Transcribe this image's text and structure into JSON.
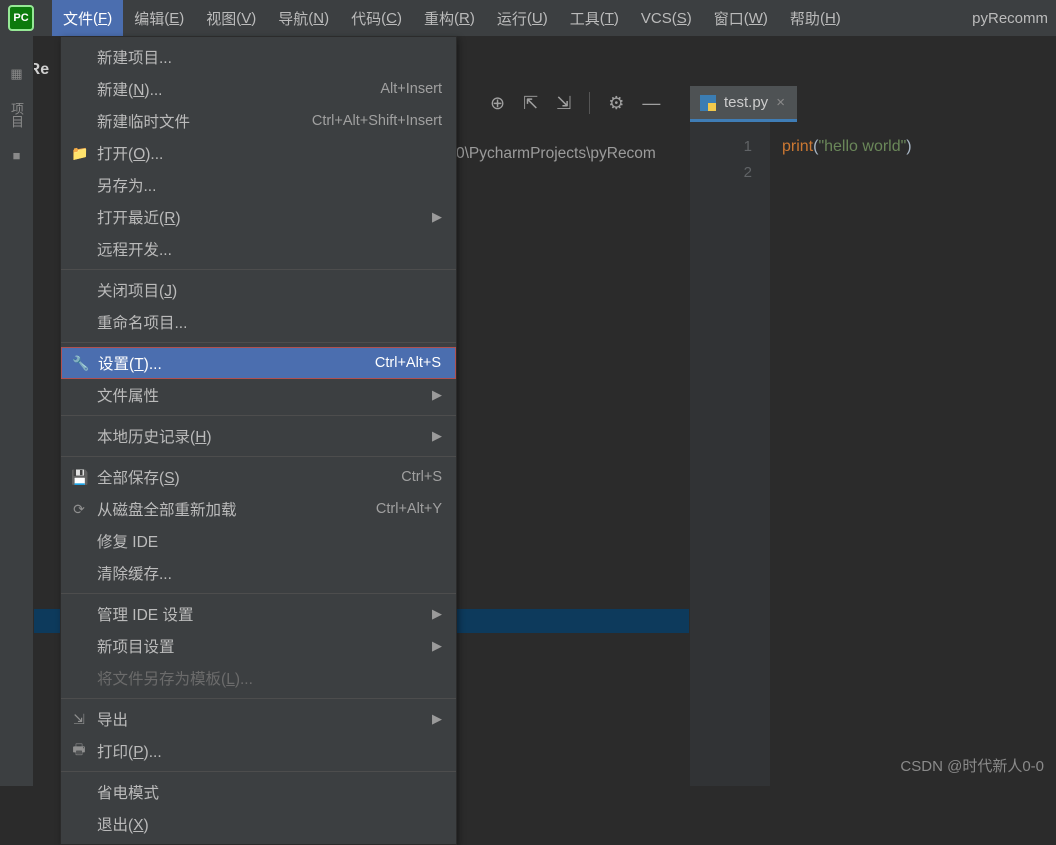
{
  "app": {
    "icon_text": "PC",
    "project_title": "pyRecomm"
  },
  "menus": {
    "file": {
      "label": "文件",
      "mn": "F"
    },
    "edit": {
      "label": "编辑",
      "mn": "E"
    },
    "view": {
      "label": "视图",
      "mn": "V"
    },
    "navigate": {
      "label": "导航",
      "mn": "N"
    },
    "code": {
      "label": "代码",
      "mn": "C"
    },
    "refactor": {
      "label": "重构",
      "mn": "R"
    },
    "run": {
      "label": "运行",
      "mn": "U"
    },
    "tools": {
      "label": "工具",
      "mn": "T"
    },
    "vcs": {
      "label": "VCS",
      "mn": "S"
    },
    "window": {
      "label": "窗口",
      "mn": "W"
    },
    "help": {
      "label": "帮助",
      "mn": "H"
    }
  },
  "sidebar": {
    "proj_label": "pyRe",
    "vertical": "项目"
  },
  "dropdown": {
    "new_project": {
      "label": "新建项目..."
    },
    "new": {
      "label": "新建",
      "mn": "N",
      "suffix": "...",
      "shortcut": "Alt+Insert"
    },
    "new_scratch": {
      "label": "新建临时文件",
      "shortcut": "Ctrl+Alt+Shift+Insert"
    },
    "open": {
      "label": "打开",
      "mn": "O",
      "suffix": "..."
    },
    "save_as": {
      "label": "另存为..."
    },
    "open_recent": {
      "label": "打开最近",
      "mn": "R"
    },
    "remote_dev": {
      "label": "远程开发..."
    },
    "close_project": {
      "label": "关闭项目",
      "mn": "J"
    },
    "rename_project": {
      "label": "重命名项目..."
    },
    "settings": {
      "label": "设置",
      "mn": "T",
      "suffix": "...",
      "shortcut": "Ctrl+Alt+S"
    },
    "file_props": {
      "label": "文件属性"
    },
    "local_history": {
      "label": "本地历史记录",
      "mn": "H"
    },
    "save_all": {
      "label": "全部保存",
      "mn": "S",
      "shortcut": "Ctrl+S"
    },
    "reload_disk": {
      "label": "从磁盘全部重新加载",
      "shortcut": "Ctrl+Alt+Y"
    },
    "repair_ide": {
      "label": "修复 IDE"
    },
    "invalidate_cache": {
      "label": "清除缓存..."
    },
    "manage_ide": {
      "label": "管理 IDE 设置"
    },
    "new_proj_settings": {
      "label": "新项目设置"
    },
    "save_template": {
      "label": "将文件另存为模板",
      "mn": "L",
      "suffix": "..."
    },
    "export": {
      "label": "导出"
    },
    "print": {
      "label": "打印",
      "mn": "P",
      "suffix": "..."
    },
    "power_save": {
      "label": "省电模式"
    },
    "exit": {
      "label": "退出",
      "mn": "X"
    }
  },
  "path": {
    "text": "0\\PycharmProjects\\pyRecom"
  },
  "tab": {
    "filename": "test.py",
    "close": "×"
  },
  "editor": {
    "lines": [
      "1",
      "2"
    ],
    "code": {
      "fn": "print",
      "lp": "(",
      "str": "\"hello world\"",
      "rp": ")"
    }
  },
  "watermark": "CSDN @时代新人0-0"
}
